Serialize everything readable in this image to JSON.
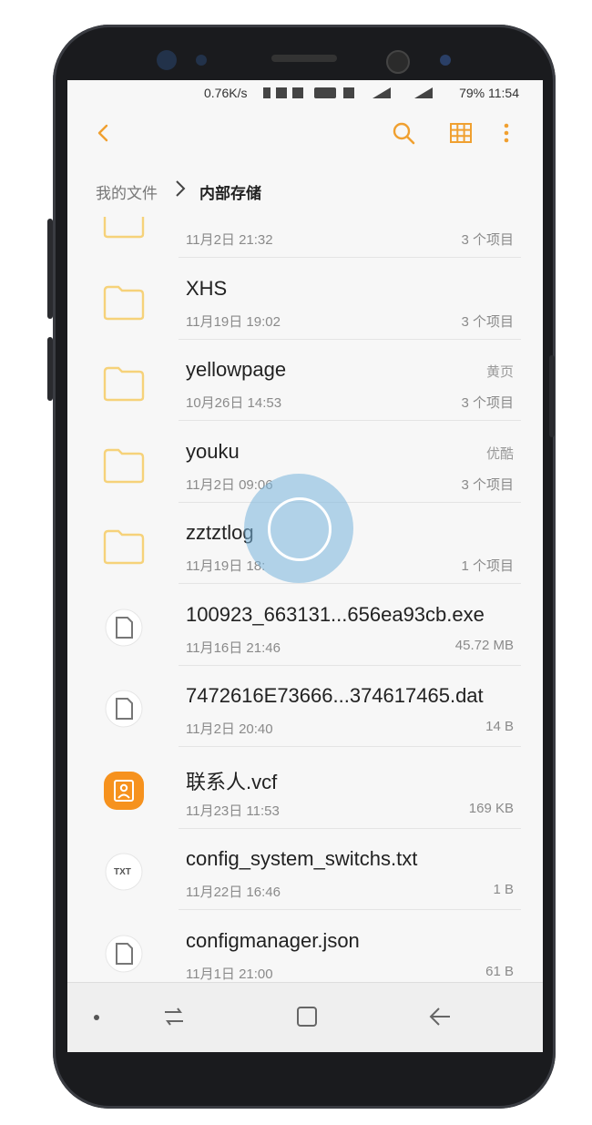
{
  "status": {
    "speed": "0.76K/s",
    "right": "79%  11:54"
  },
  "breadcrumb": {
    "root": "我的文件",
    "current": "内部存储"
  },
  "rows": [
    {
      "name": "",
      "date": "11月2日 21:32",
      "meta": "3 个项目",
      "tag": "",
      "icon": "folder-icon"
    },
    {
      "name": "XHS",
      "date": "11月19日 19:02",
      "meta": "3 个项目",
      "tag": "",
      "icon": "folder-icon"
    },
    {
      "name": "yellowpage",
      "date": "10月26日 14:53",
      "meta": "3 个项目",
      "tag": "黄页",
      "icon": "folder-icon"
    },
    {
      "name": "youku",
      "date": "11月2日 09:06",
      "meta": "3 个项目",
      "tag": "优酷",
      "icon": "folder-icon"
    },
    {
      "name": "zztztlog",
      "date": "11月19日 18:",
      "meta": "1 个项目",
      "tag": "",
      "icon": "folder-icon"
    },
    {
      "name": "100923_663131...656ea93cb.exe",
      "date": "11月16日 21:46",
      "meta": "45.72 MB",
      "tag": "",
      "icon": "file-icon"
    },
    {
      "name": "7472616E73666...374617465.dat",
      "date": "11月2日 20:40",
      "meta": "14 B",
      "tag": "",
      "icon": "file-icon"
    },
    {
      "name": "联系人.vcf",
      "date": "11月23日 11:53",
      "meta": "169 KB",
      "tag": "",
      "icon": "contact-icon"
    },
    {
      "name": "config_system_switchs.txt",
      "date": "11月22日 16:46",
      "meta": "1 B",
      "tag": "",
      "icon": "txt-icon"
    },
    {
      "name": "configmanager.json",
      "date": "11月1日 21:00",
      "meta": "61 B",
      "tag": "",
      "icon": "file-icon"
    }
  ],
  "icons": {
    "txt_label": "TXT"
  },
  "colors": {
    "accent": "#f0a030",
    "folder": "#f6d27a",
    "contact": "#f6921e"
  }
}
